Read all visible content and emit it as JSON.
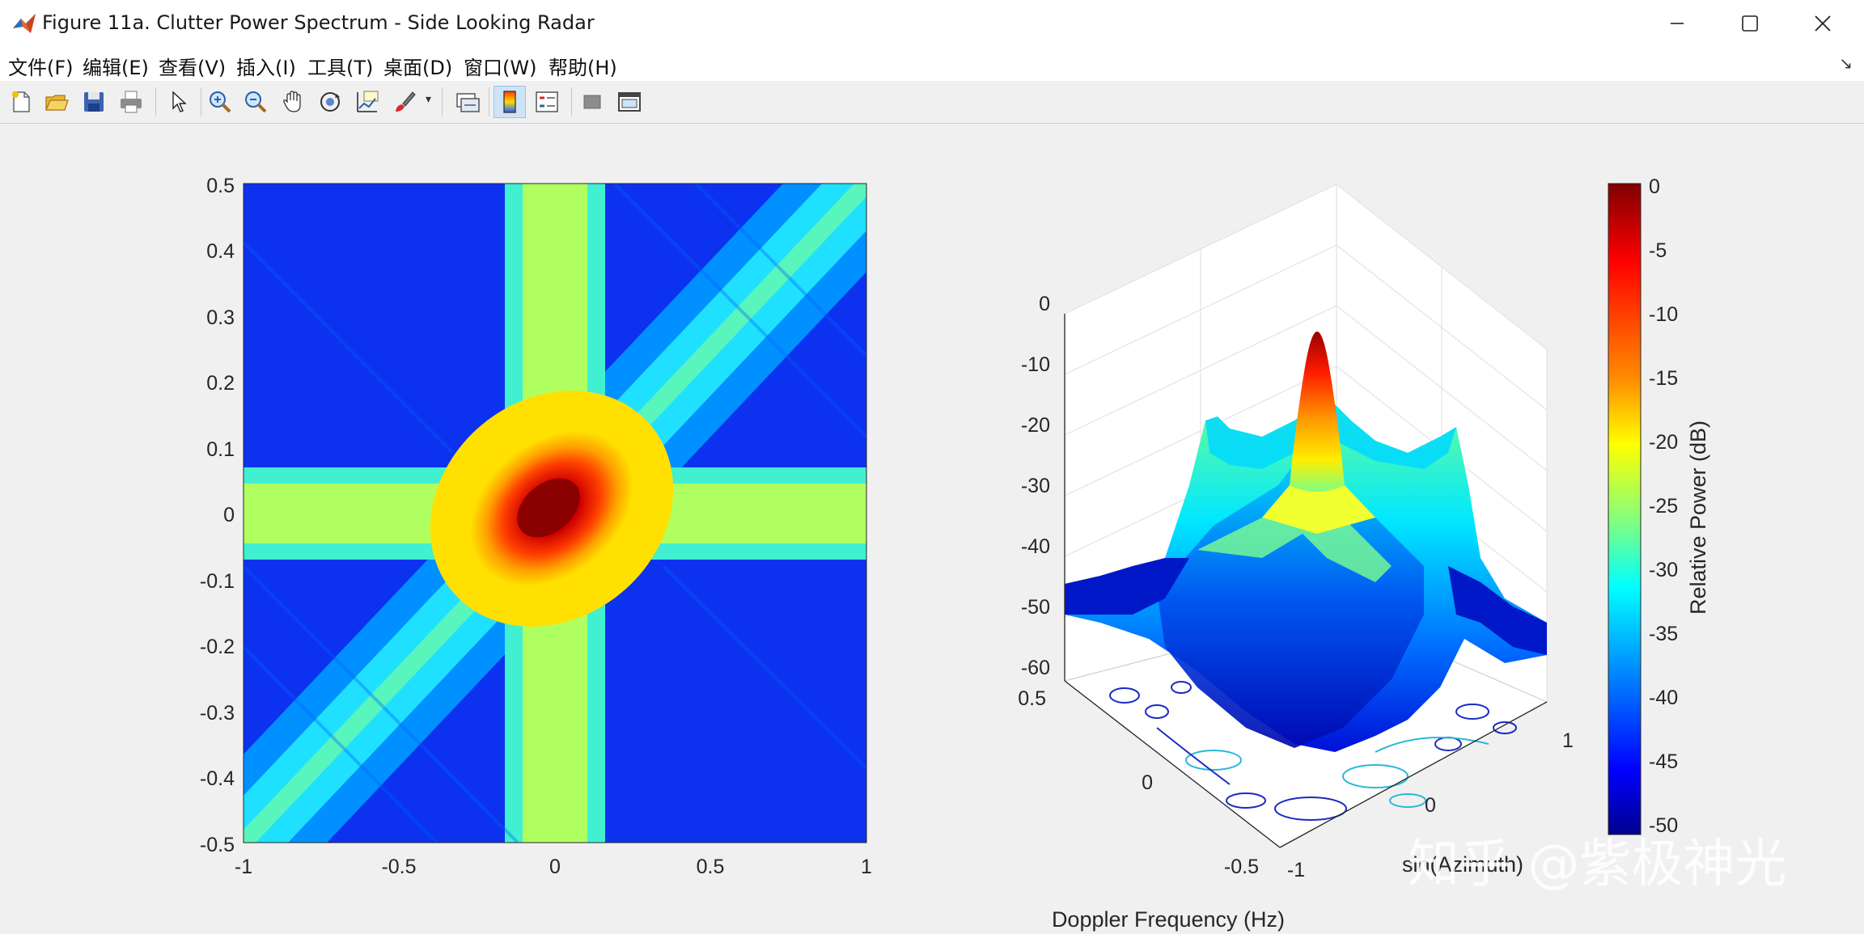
{
  "window": {
    "title": "Figure 11a. Clutter Power Spectrum - Side Looking Radar",
    "icon": "matlab-icon",
    "controls": [
      "minimize-icon",
      "maximize-icon",
      "close-icon"
    ]
  },
  "menu": {
    "items": [
      "文件(F)",
      "编辑(E)",
      "查看(V)",
      "插入(I)",
      "工具(T)",
      "桌面(D)",
      "窗口(W)",
      "帮助(H)"
    ],
    "dock_arrow": "↘"
  },
  "toolbar": {
    "buttons": [
      "new-figure-icon",
      "open-icon",
      "save-icon",
      "print-icon",
      "pointer-icon",
      "zoom-in-icon",
      "zoom-out-icon",
      "pan-icon",
      "rotate-3d-icon",
      "data-cursor-icon",
      "brush-icon",
      "link-icon",
      "colorbar-icon",
      "legend-icon",
      "hide-plot-tools-icon",
      "show-plot-tools-icon"
    ]
  },
  "chart_data": [
    {
      "type": "heatmap",
      "description_axes": "2D clutter power spectrum",
      "x_ticks": [
        "-1",
        "-0.5",
        "0",
        "0.5",
        "1"
      ],
      "y_ticks": [
        "0.5",
        "0.4",
        "0.3",
        "0.2",
        "0.1",
        "0",
        "-0.1",
        "-0.2",
        "-0.3",
        "-0.4",
        "-0.5"
      ],
      "xlim": [
        -1,
        1
      ],
      "ylim": [
        -0.5,
        0.5
      ],
      "peak": {
        "x": 0,
        "y": 0,
        "value_db": 0
      },
      "colormap": "jet"
    },
    {
      "type": "surface",
      "z_ticks": [
        "0",
        "-10",
        "-20",
        "-30",
        "-40",
        "-50",
        "-60"
      ],
      "zlim": [
        -60,
        0
      ],
      "doppler_ticks": [
        "0.5",
        "0",
        "-0.5"
      ],
      "azimuth_ticks": [
        "1",
        "0",
        "-1"
      ],
      "xlabel": "Doppler Frequency (Hz)",
      "ylabel": "sin(Azimuth)",
      "peak_db": 0,
      "colorbar": {
        "label": "Relative Power (dB)",
        "ticks": [
          "0",
          "-5",
          "-10",
          "-15",
          "-20",
          "-25",
          "-30",
          "-35",
          "-40",
          "-45",
          "-50"
        ],
        "range": [
          -50,
          0
        ],
        "colors": [
          "#800000",
          "#ff0000",
          "#ff8000",
          "#ffff00",
          "#80ff80",
          "#00ffff",
          "#0080ff",
          "#0000ff",
          "#00008f"
        ]
      }
    }
  ],
  "watermark": "知乎 @紫极神光"
}
